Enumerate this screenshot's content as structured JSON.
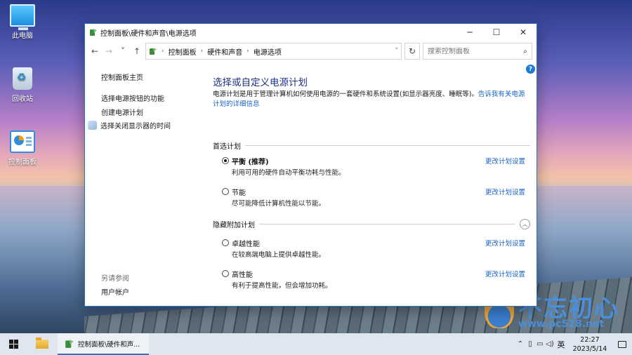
{
  "desktop": {
    "icons": [
      {
        "label": "此电脑",
        "icon": "computer-icon"
      },
      {
        "label": "回收站",
        "icon": "recycle-bin-icon"
      },
      {
        "label": "控制面板",
        "icon": "control-panel-icon"
      }
    ],
    "watermark": {
      "title": "不忘初心",
      "url": "www.pc528.net"
    }
  },
  "window": {
    "title": "控制面板\\硬件和声音\\电源选项",
    "breadcrumb": [
      "控制面板",
      "硬件和声音",
      "电源选项"
    ],
    "search_placeholder": "搜索控制面板",
    "controls": {
      "minimize": "─",
      "maximize": "☐",
      "close": "✕"
    },
    "nav": {
      "back": "←",
      "forward": "→",
      "recent": "˅",
      "up": "↑",
      "dropdown": "˅",
      "refresh": "↻",
      "help": "?"
    }
  },
  "sidebar": {
    "home": "控制面板主页",
    "links": [
      "选择电源按钮的功能",
      "创建电源计划",
      "选择关闭显示器的时间"
    ],
    "see_also_heading": "另请参阅",
    "see_also": [
      "用户帐户"
    ]
  },
  "main": {
    "title": "选择或自定义电源计划",
    "description": "电源计划是用于管理计算机如何使用电源的一套硬件和系统设置(如显示器亮度、睡眠等)。",
    "description_link": "告诉我有关电源计划的详细信息",
    "preferred_heading": "首选计划",
    "hidden_heading": "隐藏附加计划",
    "change_label": "更改计划设置",
    "preferred_plans": [
      {
        "name": "平衡 (推荐)",
        "desc": "利用可用的硬件自动平衡功耗与性能。",
        "selected": true
      },
      {
        "name": "节能",
        "desc": "尽可能降低计算机性能以节能。",
        "selected": false
      }
    ],
    "hidden_plans": [
      {
        "name": "卓越性能",
        "desc": "在较高端电脑上提供卓越性能。",
        "selected": false
      },
      {
        "name": "高性能",
        "desc": "有利于提高性能，但会增加功耗。",
        "selected": false
      }
    ]
  },
  "taskbar": {
    "task_label": "控制面板\\硬件和声...",
    "ime": "英",
    "time": "22:27",
    "date": "2023/5/14"
  }
}
